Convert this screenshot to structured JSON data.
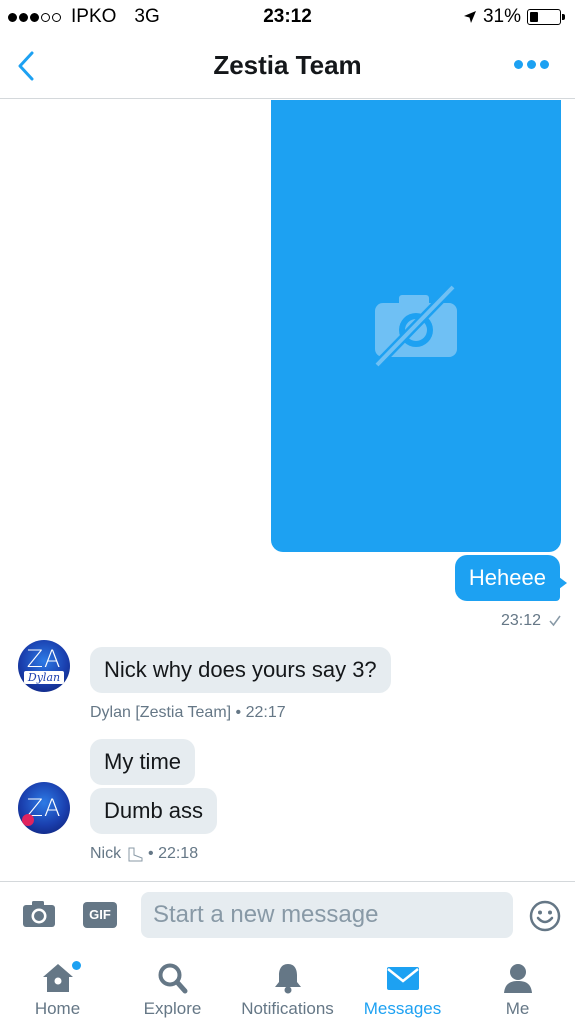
{
  "status_bar": {
    "carrier": "IPKO",
    "network": "3G",
    "time": "23:12",
    "battery": "31%",
    "battery_level": 0.31
  },
  "header": {
    "title": "Zestia Team"
  },
  "conversation": {
    "sent_text": "Heheee",
    "sent_time": "23:12",
    "received": [
      {
        "avatar_text": "ZA",
        "avatar_name": "Dylan",
        "messages": [
          "Nick why does yours say 3?"
        ],
        "sender": "Dylan [Zestia Team]",
        "time": "22:17"
      },
      {
        "avatar_text": "ZA",
        "messages": [
          "My time",
          "Dumb ass"
        ],
        "sender": "Nick",
        "time": "22:18"
      }
    ]
  },
  "composer": {
    "gif_label": "GIF",
    "placeholder": "Start a new message"
  },
  "tabs": [
    {
      "label": "Home",
      "icon": "home-icon",
      "active": false
    },
    {
      "label": "Explore",
      "icon": "search-icon",
      "active": false
    },
    {
      "label": "Notifications",
      "icon": "bell-icon",
      "active": false
    },
    {
      "label": "Messages",
      "icon": "envelope-icon",
      "active": true
    },
    {
      "label": "Me",
      "icon": "person-icon",
      "active": false
    }
  ],
  "colors": {
    "accent": "#1da1f2",
    "bubble_received": "#e6ecf0",
    "meta_text": "#657786"
  }
}
